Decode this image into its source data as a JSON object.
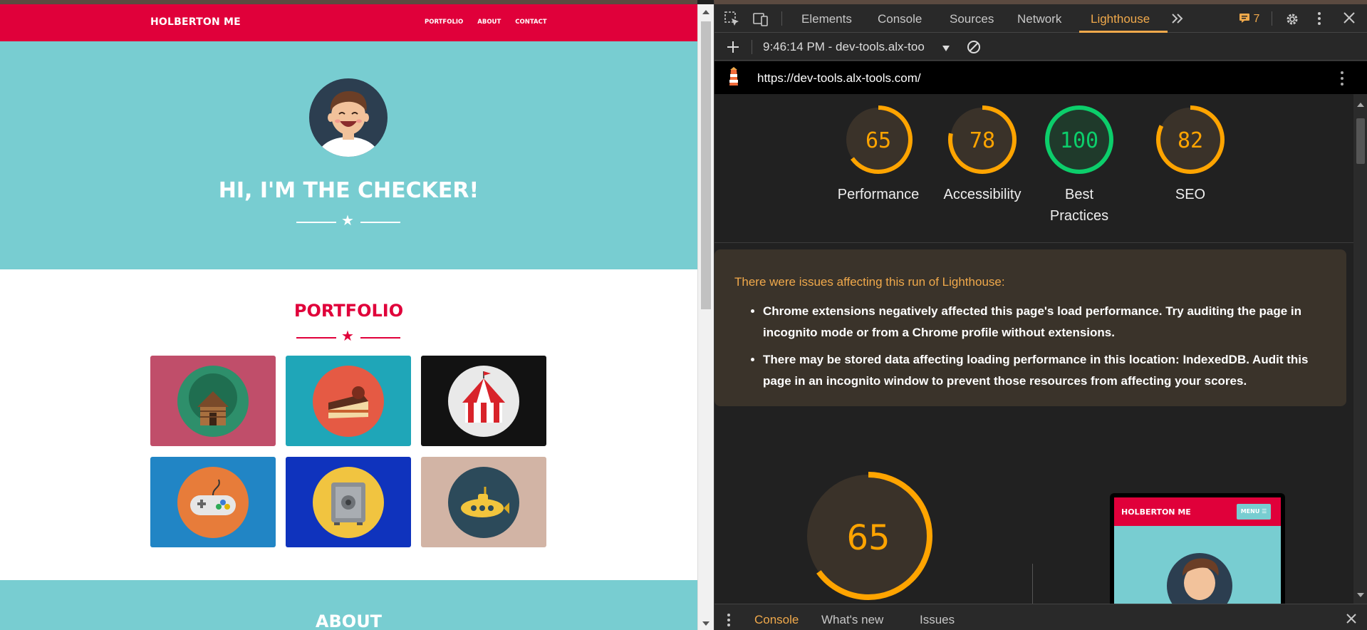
{
  "website": {
    "brand": "HOLBERTON ME",
    "nav": [
      {
        "label": "PORTFOLIO"
      },
      {
        "label": "ABOUT"
      },
      {
        "label": "CONTACT"
      }
    ],
    "hero_title": "HI, I'M THE CHECKER!",
    "portfolio_title": "PORTFOLIO",
    "about_title": "ABOUT",
    "tiles": [
      {
        "name": "log-cabin",
        "bg": "#c04e6a",
        "circle": "#2e8f6b"
      },
      {
        "name": "cake-slice",
        "bg": "#1fa6b8",
        "circle": "#e55a44"
      },
      {
        "name": "circus-tent",
        "bg": "#121212",
        "circle": "#e9e9e9"
      },
      {
        "name": "game-controller",
        "bg": "#2185c5",
        "circle": "#e77c3a"
      },
      {
        "name": "safe-vault",
        "bg": "#0f33bd",
        "circle": "#f1c440"
      },
      {
        "name": "submarine",
        "bg": "#d2b4a5",
        "circle": "#2c4a5a"
      }
    ]
  },
  "devtools": {
    "tabs": [
      {
        "label": "Elements"
      },
      {
        "label": "Console"
      },
      {
        "label": "Sources"
      },
      {
        "label": "Network"
      },
      {
        "label": "Lighthouse"
      }
    ],
    "issues_count": "7",
    "report_time": "9:46:14 PM - dev-tools.alx-too",
    "report_url": "https://dev-tools.alx-tools.com/",
    "scores": [
      {
        "value": "65",
        "label": "Performance",
        "score": 0.65,
        "color": "#ffa400",
        "bg": "#3a3229"
      },
      {
        "value": "78",
        "label": "Accessibility",
        "score": 0.78,
        "color": "#ffa400",
        "bg": "#3a3229"
      },
      {
        "value": "100",
        "label": "Best Practices",
        "score": 1.0,
        "color": "#0cce6b",
        "bg": "#1f3a2b"
      },
      {
        "value": "82",
        "label": "SEO",
        "score": 0.82,
        "color": "#ffa400",
        "bg": "#3a3229"
      }
    ],
    "warning": {
      "title": "There were issues affecting this run of Lighthouse:",
      "items": [
        "Chrome extensions negatively affected this page's load performance. Try auditing the page in incognito mode or from a Chrome profile without extensions.",
        "There may be stored data affecting loading performance in this location: IndexedDB. Audit this page in an incognito window to prevent those resources from affecting your scores."
      ]
    },
    "big_score": {
      "value": "65",
      "score": 0.65
    },
    "preview": {
      "brand": "HOLBERTON ME",
      "menu": "MENU ☰"
    },
    "drawer_tabs": [
      {
        "label": "Console"
      },
      {
        "label": "What's new"
      },
      {
        "label": "Issues"
      }
    ]
  }
}
